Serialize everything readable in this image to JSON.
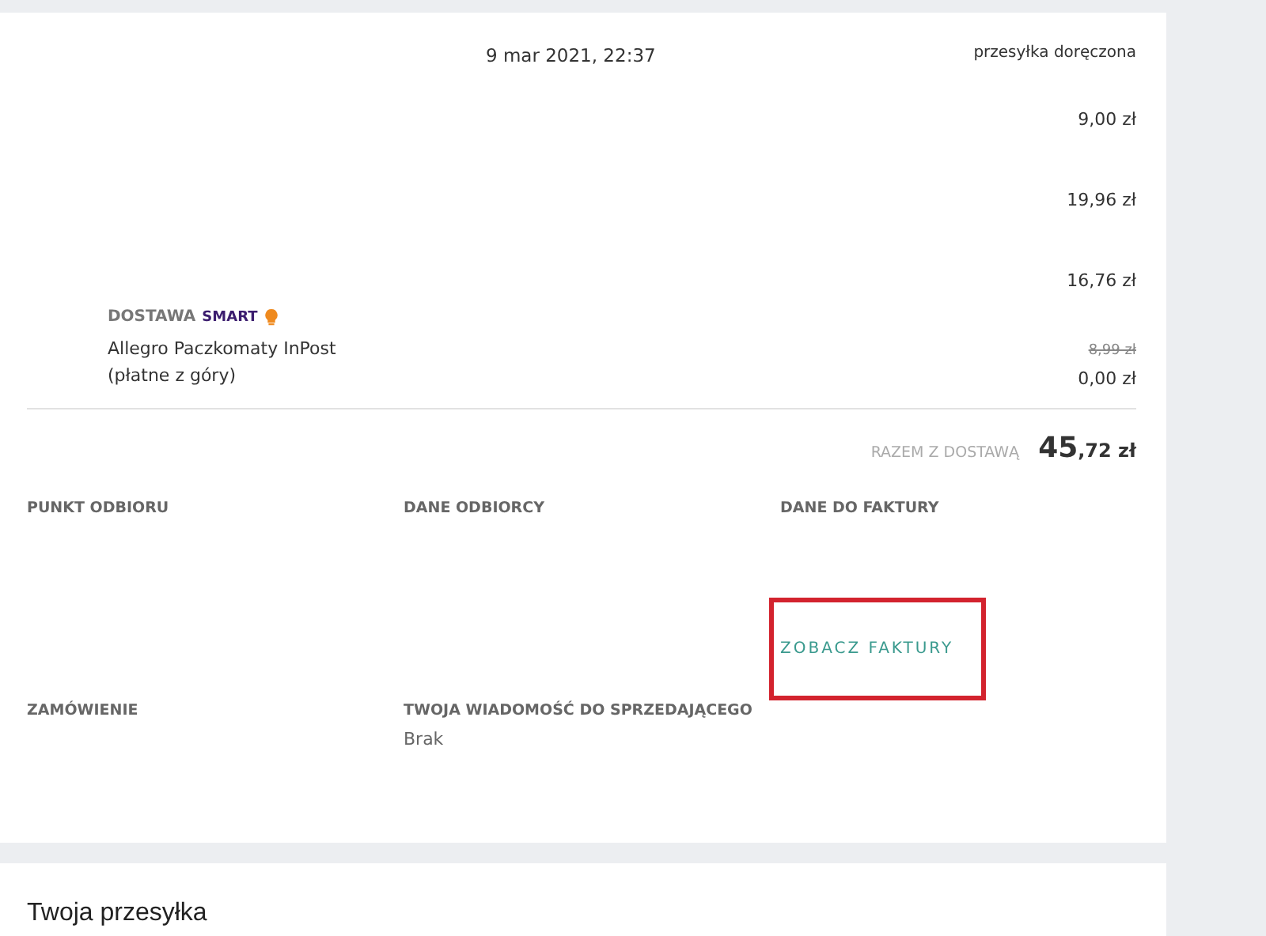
{
  "order": {
    "date": "9 mar 2021, 22:37",
    "status": "przesyłka doręczona",
    "item_prices": [
      "9,00 zł",
      "19,96 zł",
      "16,76 zł"
    ],
    "delivery": {
      "label": "DOSTAWA",
      "badge": "SMART",
      "method": "Allegro Paczkomaty InPost",
      "payment_note": "(płatne z góry)",
      "old_price": "8,99 zł",
      "price": "0,00 zł"
    },
    "total": {
      "label": "RAZEM Z DOSTAWĄ",
      "whole": "45",
      "fraction": ",72 zł"
    },
    "details": [
      {
        "heading": "PUNKT ODBIORU"
      },
      {
        "heading": "DANE ODBIORCY"
      },
      {
        "heading": "DANE DO FAKTURY"
      },
      {
        "heading": "ZAMÓWIENIE"
      },
      {
        "heading": "TWOJA WIADOMOŚĆ DO SPRZEDAJĄCEGO",
        "value": "Brak"
      }
    ],
    "invoice_button": {
      "label": "ZOBACZ FAKTURY",
      "highlighted": true
    }
  },
  "shipment": {
    "title": "Twoja przesyłka"
  }
}
